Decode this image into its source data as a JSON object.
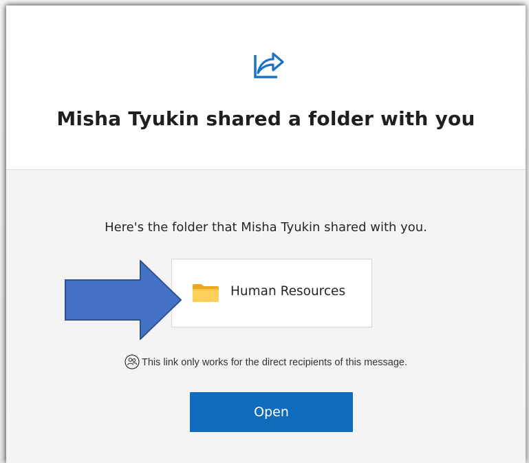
{
  "header": {
    "icon": "share-arrow-icon",
    "title": "Misha Tyukin shared a folder with you"
  },
  "body": {
    "message": "Here's the folder that Misha Tyukin shared with you.",
    "folder": {
      "icon": "folder-icon",
      "name": "Human Resources"
    },
    "annotation": {
      "icon": "blue-pointer-arrow",
      "color": "#4472c4"
    },
    "notice": {
      "icon": "people-icon",
      "text": "This link only works for the direct recipients of this message."
    },
    "open_button": {
      "label": "Open",
      "color": "#0f6cbd"
    }
  },
  "colors": {
    "accent": "#0f6cbd",
    "folder": "#f5c84c",
    "arrow": "#4472c4"
  }
}
